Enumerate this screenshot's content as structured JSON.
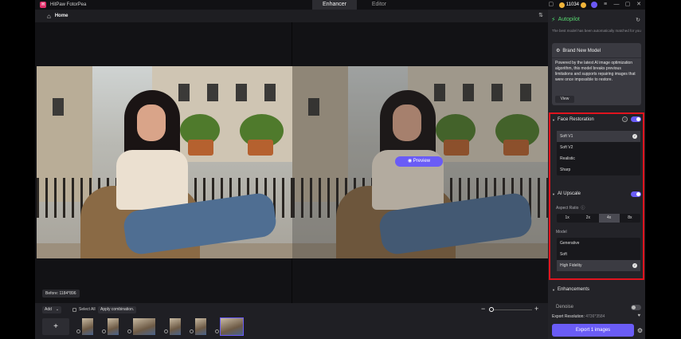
{
  "window": {
    "app_title": "HitPaw FotorPea",
    "logo_letter": "H",
    "modes": [
      "Enhancer",
      "Editor"
    ],
    "active_mode": "Enhancer",
    "credits": "11034"
  },
  "header": {
    "home_label": "Home"
  },
  "canvas": {
    "preview_label": "Preview",
    "before_badge": "Before: 1184*896"
  },
  "bottombar": {
    "add_label": "Add",
    "select_all_label": "Select All",
    "apply_label": "Apply combination.",
    "add_tile_symbol": "+",
    "zoom": {
      "minus": "−",
      "plus": "+"
    },
    "thumbnails": [
      {
        "selected": false
      },
      {
        "selected": false
      },
      {
        "selected": false
      },
      {
        "selected": false
      },
      {
        "selected": false
      },
      {
        "selected": true
      }
    ]
  },
  "panel": {
    "autopilot": {
      "title": "Autopilot",
      "description": "The best model has been automatically matched for you"
    },
    "model_card": {
      "title": "Brand New Model",
      "text": "Powered by the latest AI image optimization algorithm, this model breaks previous limitations and supports repairing images that were once impossible to restore.",
      "view_label": "View"
    },
    "face_restoration": {
      "title": "Face Restoration",
      "enabled": true,
      "options": [
        "Soft V1",
        "Soft V2",
        "Realistic",
        "Sharp"
      ],
      "selected": "Soft V1"
    },
    "ai_upscale": {
      "title": "AI Upscale",
      "enabled": true,
      "aspect_ratio_label": "Aspect Ratio",
      "ratios": [
        "1x",
        "2x",
        "4x",
        "8x"
      ],
      "selected_ratio": "4x",
      "model_label": "Model",
      "models": [
        "Generative",
        "Soft",
        "High Fidelity"
      ],
      "selected_model": "High Fidelity"
    },
    "enhancements": {
      "title": "Enhancements"
    },
    "denoise": {
      "label": "Denoise",
      "enabled": false
    },
    "export": {
      "resolution_label": "Export Resolution:",
      "resolution_value": "4736*3584",
      "button_label": "Export 1 images"
    }
  },
  "colors": {
    "accent": "#6a5cf6",
    "autopilot_green": "#56d46f",
    "highlight_red": "#e0141e"
  }
}
